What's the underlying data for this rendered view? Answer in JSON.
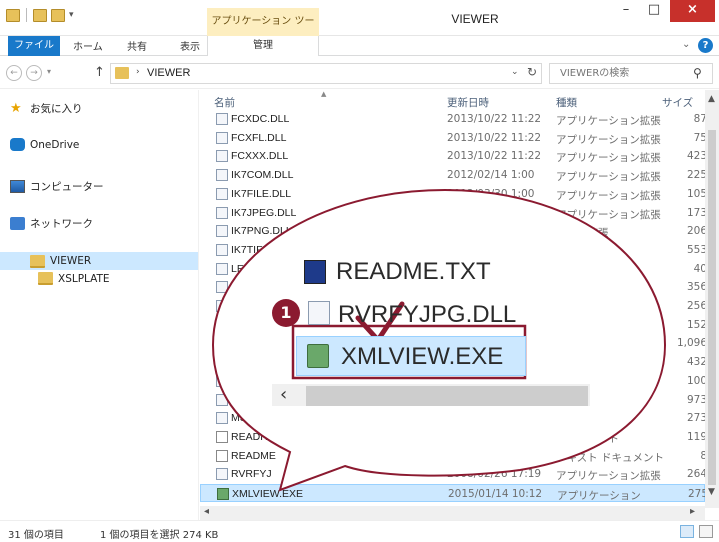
{
  "titlebar": {
    "context_tab": "アプリケーション ツール",
    "window_title": "VIEWER",
    "minimize": "–",
    "maximize": "□",
    "close": "×"
  },
  "ribbon": {
    "tabs": {
      "file": "ファイル",
      "home": "ホーム",
      "share": "共有",
      "view": "表示",
      "manage": "管理"
    },
    "expand": "⌄",
    "help": "?"
  },
  "address": {
    "path": "VIEWER",
    "search_placeholder": "VIEWERの検索"
  },
  "nav": {
    "favorites": "お気に入り",
    "onedrive": "OneDrive",
    "computer": "コンピューター",
    "network": "ネットワーク",
    "viewer": "VIEWER",
    "xslplate": "XSLPLATE"
  },
  "columns": {
    "name": "名前",
    "date": "更新日時",
    "type": "種類",
    "size": "サイズ"
  },
  "files": [
    {
      "name": "FCXDC.DLL",
      "date": "2013/10/22 11:22",
      "type": "アプリケーション拡張",
      "size": "87"
    },
    {
      "name": "FCXFL.DLL",
      "date": "2013/10/22 11:22",
      "type": "アプリケーション拡張",
      "size": "75"
    },
    {
      "name": "FCXXX.DLL",
      "date": "2013/10/22 11:22",
      "type": "アプリケーション拡張",
      "size": "423"
    },
    {
      "name": "IK7COM.DLL",
      "date": "2012/02/14 1:00",
      "type": "アプリケーション拡張",
      "size": "225"
    },
    {
      "name": "IK7FILE.DLL",
      "date": "2012/03/30 1:00",
      "type": "アプリケーション拡張",
      "size": "105"
    },
    {
      "name": "IK7JPEG.DLL",
      "date": "1:00",
      "type": "アプリケーション拡張",
      "size": "173"
    },
    {
      "name": "IK7PNG.DLL",
      "date": "",
      "type": "ション拡張",
      "size": "206"
    },
    {
      "name": "IK7TIFF",
      "date": "",
      "type": "ン拡張",
      "size": "553"
    },
    {
      "name": "LE",
      "date": "",
      "type": "拡張",
      "size": "40"
    },
    {
      "name": "",
      "date": "",
      "type": "",
      "size": "356"
    },
    {
      "name": "",
      "date": "",
      "type": "",
      "size": "256"
    },
    {
      "name": "",
      "date": "",
      "type": "",
      "size": "152"
    },
    {
      "name": "",
      "date": "",
      "type": "",
      "size": "1,096"
    },
    {
      "name": "",
      "date": "",
      "type": "",
      "size": "432"
    },
    {
      "name": "",
      "date": "",
      "type": "",
      "size": "100"
    },
    {
      "name": "M",
      "date": "",
      "type": "拡張",
      "size": "973"
    },
    {
      "name": "MSVC",
      "date": "",
      "type": "ン拡張",
      "size": "273"
    },
    {
      "name": "READITE",
      "date": "",
      "type": "ドキュメント",
      "size": "119"
    },
    {
      "name": "README",
      "date": "",
      "type": "テキスト ドキュメント",
      "size": "8"
    },
    {
      "name": "RVRFYJ",
      "date": "2008/02/26 17:19",
      "type": "アプリケーション拡張",
      "size": "264"
    },
    {
      "name": "XMLVIEW.EXE",
      "date": "2015/01/14 10:12",
      "type": "アプリケーション",
      "size": "275"
    }
  ],
  "zoom": {
    "readme": "README.TXT",
    "rvrf": "RVRFYJPG.DLL",
    "xml": "XMLVIEW.EXE",
    "step": "1"
  },
  "status": {
    "count": "31 個の項目",
    "selection": "1 個の項目を選択  274 KB"
  }
}
